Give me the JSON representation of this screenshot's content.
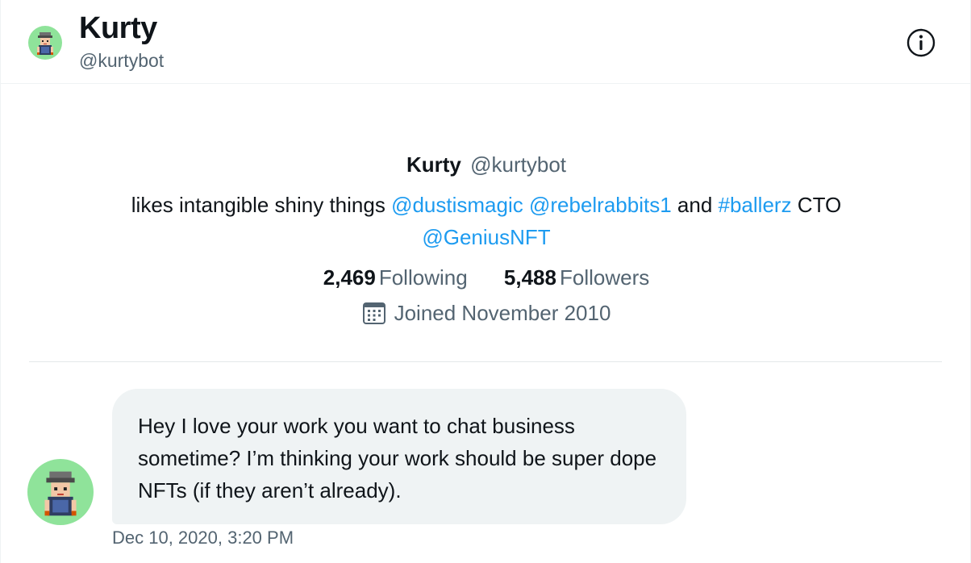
{
  "header": {
    "name": "Kurty",
    "handle": "@kurtybot"
  },
  "profile": {
    "name": "Kurty",
    "handle": "@kurtybot",
    "bio": {
      "text1": "likes intangible shiny things ",
      "mention1": "@dustismagic",
      "space1": " ",
      "mention2": "@rebelrabbits1",
      "text2": " and ",
      "hashtag": "#ballerz",
      "text3": " CTO ",
      "mention3": "@GeniusNFT"
    },
    "following_count": "2,469",
    "following_label": "Following",
    "followers_count": "5,488",
    "followers_label": "Followers",
    "joined": "Joined November 2010"
  },
  "message": {
    "text": "Hey I love your work you want to chat business sometime? I’m thinking your work should be super dope NFTs (if they aren’t already).",
    "timestamp": "Dec 10, 2020, 3:20 PM"
  },
  "colors": {
    "link": "#1d9bf0",
    "secondary_text": "#536471",
    "bubble_bg": "#eff3f4",
    "avatar_bg": "#8fe39a"
  },
  "icons": {
    "info": "info-circle-icon",
    "calendar": "calendar-icon"
  }
}
